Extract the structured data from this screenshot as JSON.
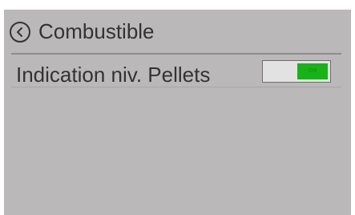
{
  "header": {
    "title": "Combustible",
    "back_icon": "chevron-left-circle-icon"
  },
  "settings": [
    {
      "label": "Indication niv. Pellets",
      "toggle": {
        "state_text": "ON",
        "on": true
      }
    }
  ],
  "colors": {
    "screen_background": "#bbb8ba",
    "text": "#333333",
    "toggle_on": "#19b219",
    "toggle_track": "#e2e2e2"
  }
}
